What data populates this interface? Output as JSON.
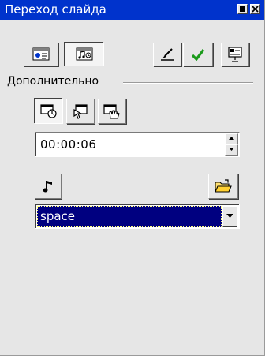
{
  "window": {
    "title": "Переход слайда",
    "minimize_icon": "minimize-icon",
    "close_icon": "close-icon"
  },
  "toolbar": {
    "effects_icon": "slide-effects-icon",
    "sound_icon": "sound-extras-icon",
    "preview_icon": "preview-brush-icon",
    "apply_icon": "apply-checkmark-icon",
    "presentation_icon": "presentation-icon"
  },
  "advanced": {
    "label": "Дополнительно",
    "mode_icons": [
      "auto-timer-icon",
      "manual-click-icon",
      "hand-click-icon"
    ],
    "time_value": "00:00:06",
    "sound_icon": "music-note-icon",
    "open_icon": "open-folder-icon",
    "sound_selected": "space"
  },
  "colors": {
    "titlebar": "#0033cc",
    "selection": "#000080",
    "panel": "#e6e6e6",
    "apply_check": "#1a9a1a"
  }
}
